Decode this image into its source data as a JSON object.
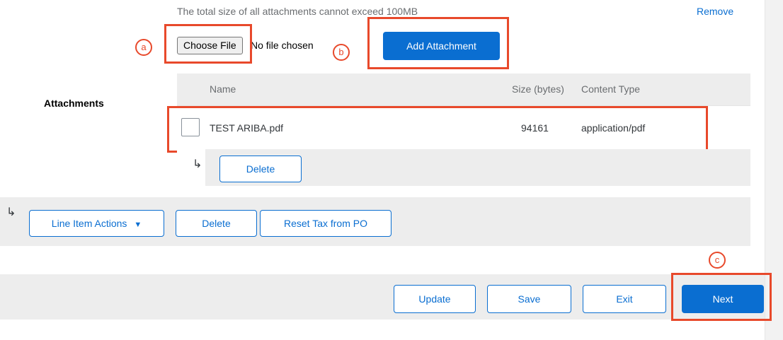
{
  "attachments": {
    "size_note": "The total size of all attachments cannot exceed 100MB",
    "remove_label": "Remove",
    "choose_file_label": "Choose File",
    "no_file_label": "No file chosen",
    "add_attachment_label": "Add Attachment",
    "section_label": "Attachments",
    "columns": [
      "Name",
      "Size (bytes)",
      "Content Type"
    ],
    "rows": [
      {
        "name": "TEST ARIBA.pdf",
        "size": "94161",
        "content_type": "application/pdf"
      }
    ],
    "sub_arrow": "↳",
    "delete_label": "Delete"
  },
  "line_actions": {
    "arrow": "↳",
    "line_item_actions_label": "Line Item Actions",
    "dropdown_caret": "▼",
    "delete_label": "Delete",
    "reset_tax_label": "Reset Tax from PO"
  },
  "footer": {
    "update_label": "Update",
    "save_label": "Save",
    "exit_label": "Exit",
    "next_label": "Next"
  },
  "callouts": {
    "a": "a",
    "b": "b",
    "c": "c"
  },
  "colors": {
    "accent": "#0a6ed1",
    "callout": "#e8492b",
    "bar_gray": "#ededed"
  }
}
